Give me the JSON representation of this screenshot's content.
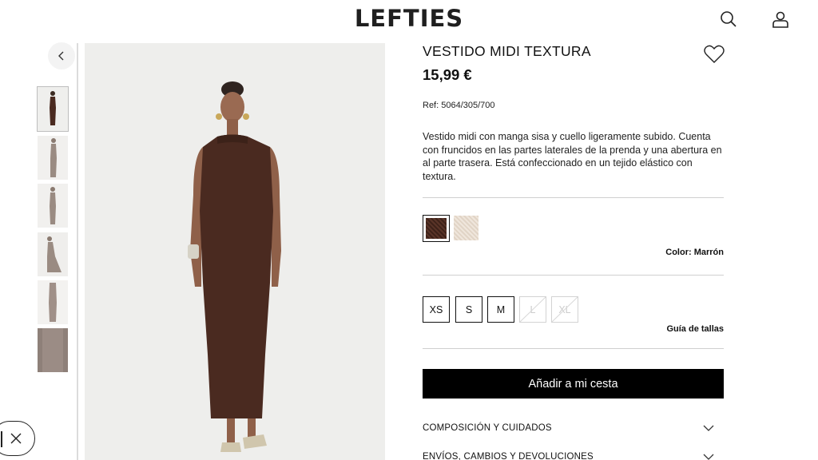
{
  "header": {
    "logo": "LEFTIES",
    "search_icon": "search-icon",
    "account_icon": "user-icon"
  },
  "gallery": {
    "back_icon": "chevron-left-icon",
    "thumbnails": [
      "thumb-1",
      "thumb-2",
      "thumb-3",
      "thumb-4",
      "thumb-5",
      "thumb-6"
    ],
    "active_index": 0
  },
  "product": {
    "name": "VESTIDO MIDI TEXTURA",
    "price": "15,99 €",
    "ref": "Ref: 5064/305/700",
    "description": "Vestido midi con manga sisa y cuello ligeramente subido. Cuenta con fruncidos en las partes laterales de la prenda y una abertura en al parte trasera. Está confeccionado en un tejido elástico con textura.",
    "favorite_icon": "heart-icon"
  },
  "colors": {
    "label": "Color: Marrón",
    "swatches": [
      {
        "name": "Marrón",
        "hex": "#4a2a20",
        "selected": true
      },
      {
        "name": "Crudo",
        "hex": "#e8ddd2",
        "selected": false
      }
    ]
  },
  "sizes": {
    "options": [
      {
        "label": "XS",
        "available": true
      },
      {
        "label": "S",
        "available": true
      },
      {
        "label": "M",
        "available": true
      },
      {
        "label": "L",
        "available": false
      },
      {
        "label": "XL",
        "available": false
      }
    ],
    "guide_label": "Guía de tallas"
  },
  "cart": {
    "add_label": "Añadir a mi cesta"
  },
  "accordions": [
    {
      "label": "COMPOSICIÓN Y CUIDADOS",
      "icon": "chevron-down-icon"
    },
    {
      "label": "ENVÍOS, CAMBIOS Y DEVOLUCIONES",
      "icon": "chevron-down-icon"
    }
  ],
  "overlay": {
    "close_icon": "close-icon"
  },
  "colors_theme": {
    "accent": "#000000",
    "background": "#ffffff",
    "dress": "#4a2a20"
  }
}
